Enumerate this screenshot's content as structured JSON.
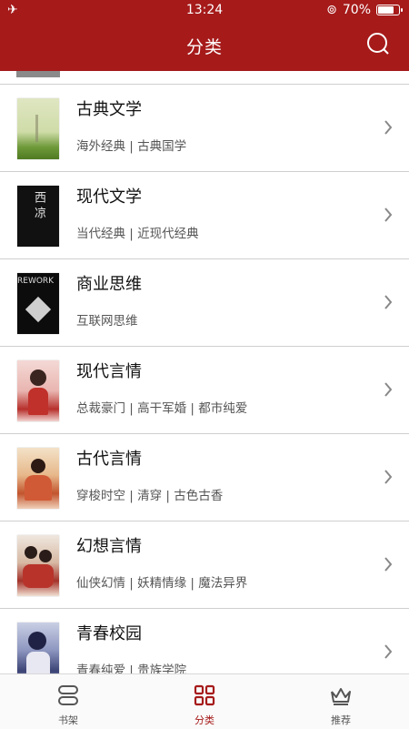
{
  "status": {
    "time": "13:24",
    "battery": "70%",
    "battery_level": 0.7
  },
  "header": {
    "title": "分类"
  },
  "categories": [
    {
      "title": "古典文学",
      "sub": "海外经典 | 古典国学"
    },
    {
      "title": "现代文学",
      "sub": "当代经典 | 近现代经典"
    },
    {
      "title": "商业思维",
      "sub": "互联网思维"
    },
    {
      "title": "现代言情",
      "sub": "总裁豪门 | 高干军婚 | 都市纯爱"
    },
    {
      "title": "古代言情",
      "sub": "穿梭时空 | 清穿 | 古色古香"
    },
    {
      "title": "幻想言情",
      "sub": "仙侠幻情 | 妖精情缘 | 魔法异界"
    },
    {
      "title": "青春校园",
      "sub": "青春纯爱 | 贵族学院"
    }
  ],
  "covers": {
    "c2_text": "西凉",
    "c3_text": "REWORK"
  },
  "tabs": [
    {
      "label": "书架"
    },
    {
      "label": "分类"
    },
    {
      "label": "推荐"
    }
  ],
  "colors": {
    "accent": "#a61a1a"
  }
}
